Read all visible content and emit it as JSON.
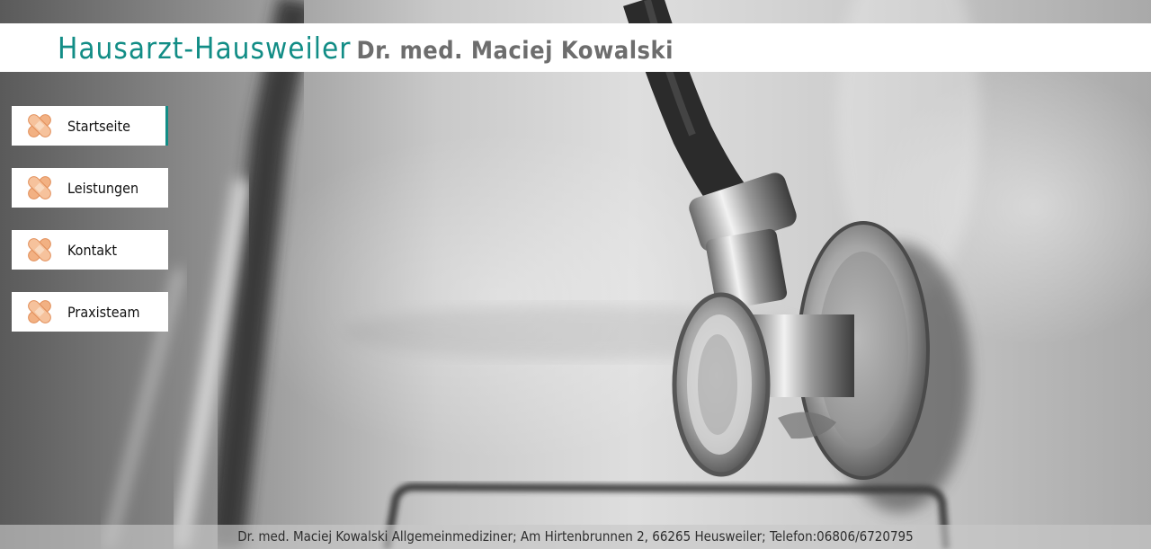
{
  "header": {
    "brand": "Hausarzt-Hausweiler",
    "doctor": "Dr. med. Maciej Kowalski"
  },
  "nav": {
    "items": [
      {
        "label": "Startseite",
        "icon": "bandage-icon",
        "active": true
      },
      {
        "label": "Leistungen",
        "icon": "bandage-icon",
        "active": false
      },
      {
        "label": "Kontakt",
        "icon": "bandage-icon",
        "active": false
      },
      {
        "label": "Praxisteam",
        "icon": "bandage-icon",
        "active": false
      }
    ]
  },
  "footer": {
    "text": "Dr. med. Maciej Kowalski Allgemeinmediziner; Am Hirtenbrunnen 2, 66265 Heusweiler; Telefon:06806/6720795"
  },
  "colors": {
    "brand": "#128d86",
    "doctor_text": "#6d6d6d",
    "bandage": "#f2b183"
  }
}
